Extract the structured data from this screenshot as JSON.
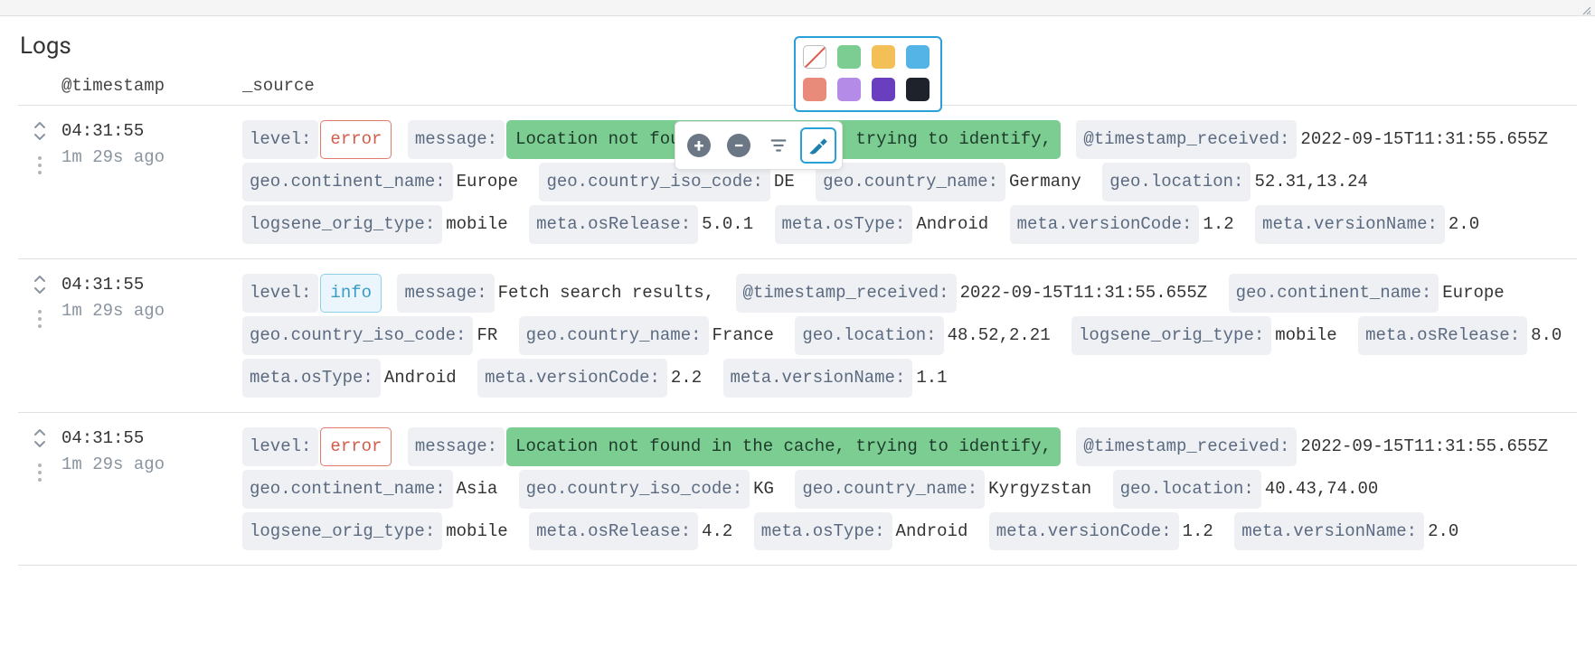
{
  "section_title": "Logs",
  "columns": {
    "timestamp": "@timestamp",
    "source": "_source"
  },
  "palette_colors": [
    "none",
    "#7bcd91",
    "#f2c057",
    "#54b4e6",
    "#e88b7a",
    "#b48ce8",
    "#6a3fbf",
    "#1e232b"
  ],
  "rows": [
    {
      "time": "04:31:55",
      "ago": "1m 29s ago",
      "fields": [
        {
          "k": "level:",
          "v": "error",
          "style": "pill-error"
        },
        {
          "k": "message:",
          "v": "Location not found in the cache, trying to identify,",
          "style": "hl"
        },
        {
          "k": "@timestamp_received:",
          "v": "2022-09-15T11:31:55.655Z"
        },
        {
          "k": "geo.continent_name:",
          "v": "Europe"
        },
        {
          "k": "geo.country_iso_code:",
          "v": "DE"
        },
        {
          "k": "geo.country_name:",
          "v": "Germany"
        },
        {
          "k": "geo.location:",
          "v": "52.31,13.24"
        },
        {
          "k": "logsene_orig_type:",
          "v": "mobile"
        },
        {
          "k": "meta.osRelease:",
          "v": "5.0.1"
        },
        {
          "k": "meta.osType:",
          "v": "Android"
        },
        {
          "k": "meta.versionCode:",
          "v": "1.2"
        },
        {
          "k": "meta.versionName:",
          "v": "2.0"
        }
      ]
    },
    {
      "time": "04:31:55",
      "ago": "1m 29s ago",
      "fields": [
        {
          "k": "level:",
          "v": "info",
          "style": "pill-info"
        },
        {
          "k": "message:",
          "v": "Fetch search results,"
        },
        {
          "k": "@timestamp_received:",
          "v": "2022-09-15T11:31:55.655Z"
        },
        {
          "k": "geo.continent_name:",
          "v": "Europe"
        },
        {
          "k": "geo.country_iso_code:",
          "v": "FR"
        },
        {
          "k": "geo.country_name:",
          "v": "France"
        },
        {
          "k": "geo.location:",
          "v": "48.52,2.21"
        },
        {
          "k": "logsene_orig_type:",
          "v": "mobile"
        },
        {
          "k": "meta.osRelease:",
          "v": "8.0"
        },
        {
          "k": "meta.osType:",
          "v": "Android"
        },
        {
          "k": "meta.versionCode:",
          "v": "2.2"
        },
        {
          "k": "meta.versionName:",
          "v": "1.1"
        }
      ]
    },
    {
      "time": "04:31:55",
      "ago": "1m 29s ago",
      "fields": [
        {
          "k": "level:",
          "v": "error",
          "style": "pill-error"
        },
        {
          "k": "message:",
          "v": "Location not found in the cache, trying to identify,",
          "style": "hl"
        },
        {
          "k": "@timestamp_received:",
          "v": "2022-09-15T11:31:55.655Z"
        },
        {
          "k": "geo.continent_name:",
          "v": "Asia"
        },
        {
          "k": "geo.country_iso_code:",
          "v": "KG"
        },
        {
          "k": "geo.country_name:",
          "v": "Kyrgyzstan"
        },
        {
          "k": "geo.location:",
          "v": "40.43,74.00"
        },
        {
          "k": "logsene_orig_type:",
          "v": "mobile"
        },
        {
          "k": "meta.osRelease:",
          "v": "4.2"
        },
        {
          "k": "meta.osType:",
          "v": "Android"
        },
        {
          "k": "meta.versionCode:",
          "v": "1.2"
        },
        {
          "k": "meta.versionName:",
          "v": "2.0"
        }
      ]
    }
  ]
}
